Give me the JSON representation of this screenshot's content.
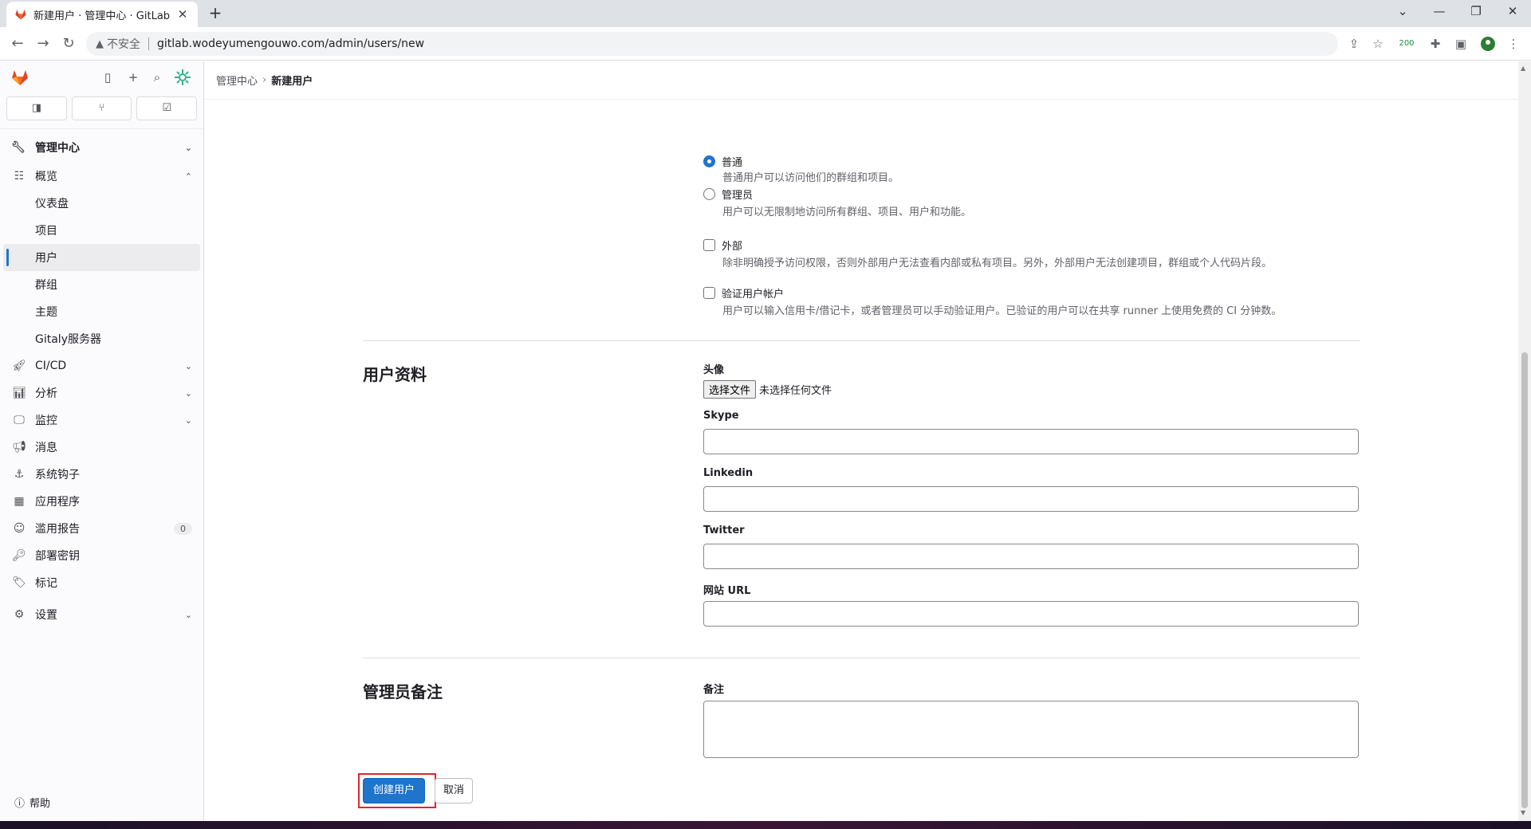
{
  "browser": {
    "tab_title": "新建用户 · 管理中心 · GitLab",
    "tab_close": "✕",
    "new_tab": "+",
    "security_label": "不安全",
    "url": "gitlab.wodeyumengouwo.com/admin/users/new",
    "ext_badge": "200"
  },
  "sidebar": {
    "section_title": "管理中心",
    "overview_label": "概览",
    "overview_items": [
      "仪表盘",
      "项目",
      "用户",
      "群组",
      "主题",
      "Gitaly服务器"
    ],
    "active_item": "用户",
    "items": [
      {
        "label": "CI/CD",
        "icon": "rocket-icon",
        "chevron": true
      },
      {
        "label": "分析",
        "icon": "chart-icon",
        "chevron": true
      },
      {
        "label": "监控",
        "icon": "monitor-icon",
        "chevron": true
      },
      {
        "label": "消息",
        "icon": "bullhorn-icon",
        "chevron": false
      },
      {
        "label": "系统钩子",
        "icon": "anchor-icon",
        "chevron": false
      },
      {
        "label": "应用程序",
        "icon": "apps-icon",
        "chevron": false
      },
      {
        "label": "滥用报告",
        "icon": "smile-icon",
        "chevron": false,
        "badge": "0"
      },
      {
        "label": "部署密钥",
        "icon": "key-icon",
        "chevron": false
      },
      {
        "label": "标记",
        "icon": "label-icon",
        "chevron": false
      }
    ],
    "settings_label": "设置",
    "help_label": "帮助"
  },
  "breadcrumb": {
    "parent": "管理中心",
    "current": "新建用户"
  },
  "access": {
    "regular_label": "普通",
    "regular_desc": "普通用户可以访问他们的群组和项目。",
    "admin_label": "管理员",
    "admin_desc": "用户可以无限制地访问所有群组、项目、用户和功能。",
    "external_label": "外部",
    "external_desc": "除非明确授予访问权限，否则外部用户无法查看内部或私有项目。另外，外部用户无法创建项目，群组或个人代码片段。",
    "validate_label": "验证用户帐户",
    "validate_desc": "用户可以输入信用卡/借记卡，或者管理员可以手动验证用户。已验证的用户可以在共享 runner 上使用免费的 CI 分钟数。"
  },
  "profile": {
    "title": "用户资料",
    "avatar_label": "头像",
    "file_button": "选择文件",
    "file_status": "未选择任何文件",
    "skype_label": "Skype",
    "linkedin_label": "Linkedin",
    "twitter_label": "Twitter",
    "website_label": "网站 URL"
  },
  "admin_notes": {
    "title": "管理员备注",
    "note_label": "备注"
  },
  "actions": {
    "create_label": "创建用户",
    "cancel_label": "取消"
  },
  "colors": {
    "primary": "#1f75cb",
    "highlight": "#e0262f",
    "gitlab_orange": "#e24329"
  }
}
